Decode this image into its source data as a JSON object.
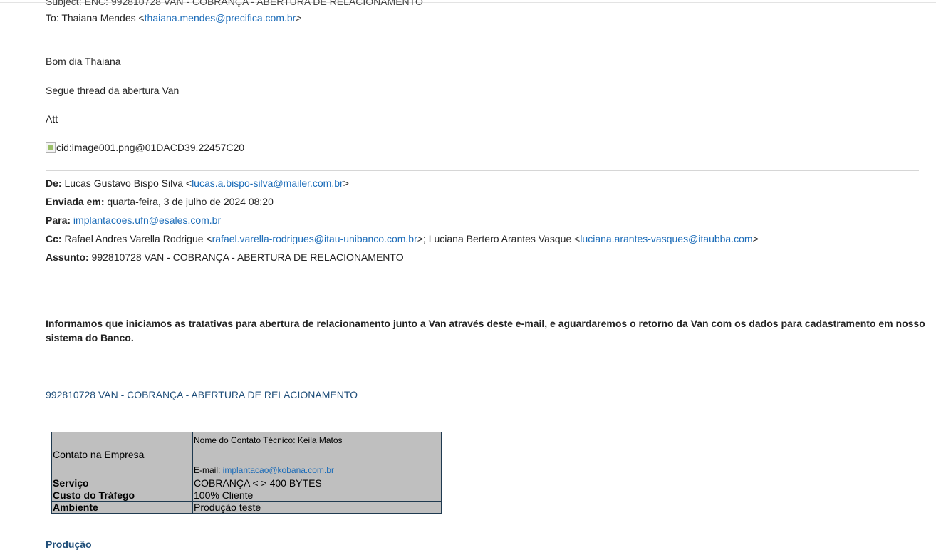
{
  "forward": {
    "subject_line": "Subject: ENC: 992810728 VAN - COBRANÇA - ABERTURA DE RELACIONAMENTO",
    "to_prefix": "To: Thaiana Mendes <",
    "to_email": "thaiana.mendes@precifica.com.br",
    "to_suffix": ">"
  },
  "body": {
    "greeting": "Bom dia Thaiana",
    "line1": "Segue thread da abertura Van",
    "signoff": "Att",
    "broken_image_alt": "cid:image001.png@01DACD39.22457C20"
  },
  "original": {
    "from_label": "De:",
    "from_name": " Lucas Gustavo Bispo Silva <",
    "from_email": "lucas.a.bispo-silva@mailer.com.br",
    "from_suffix": ">",
    "sent_label": "Enviada em:",
    "sent_value": " quarta-feira, 3 de julho de 2024 08:20",
    "to_label": "Para:",
    "to_email": "implantacoes.ufn@esales.com.br",
    "cc_label": "Cc:",
    "cc_name1": " Rafael Andres Varella Rodrigue <",
    "cc_email1": "rafael.varella-rodrigues@itau-unibanco.com.br",
    "cc_mid": ">; Luciana Bertero Arantes Vasque <",
    "cc_email2": "luciana.arantes-vasques@itaubba.com",
    "cc_suffix": ">",
    "subject_label": "Assunto:",
    "subject_value": " 992810728 VAN - COBRANÇA - ABERTURA DE RELACIONAMENTO"
  },
  "message": {
    "bold_paragraph": "Informamos que iniciamos as tratativas para abertura de relacionamento junto a Van através deste e-mail, e aguardaremos o retorno da Van com os dados para cadastramento em nosso sistema do Banco.",
    "van_title": "992810728 VAN - COBRANÇA - ABERTURA DE RELACIONAMENTO"
  },
  "table": {
    "contato_label": "Contato na Empresa",
    "contato_nome": "Nome do Contato Técnico: Keila Matos",
    "contato_email_label": "E-mail: ",
    "contato_email": "implantacao@kobana.com.br",
    "rows": [
      {
        "label": "Serviço",
        "value": "COBRANÇA < > 400 BYTES"
      },
      {
        "label": "Custo do Tráfego",
        "value": "100% Cliente"
      },
      {
        "label": "Ambiente",
        "value": "Produção teste"
      }
    ]
  },
  "footer": {
    "producao": "Produção"
  },
  "colors": {
    "link": "#1a6bb8",
    "heading_blue": "#1f4e79",
    "table_bg": "#bfbfbf"
  }
}
